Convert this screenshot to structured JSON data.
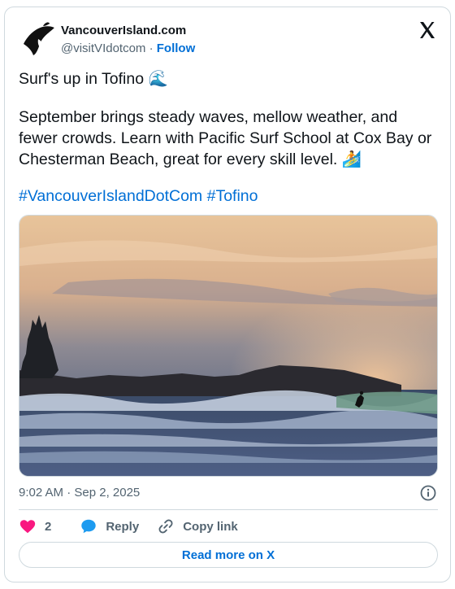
{
  "author": {
    "name": "VancouverIsland.com",
    "handle": "@visitVIdotcom",
    "separator": " · ",
    "follow_label": "Follow"
  },
  "tweet": {
    "line1": "Surf's up in Tofino",
    "line1_emoji": "🌊",
    "paragraph": "September brings steady waves, mellow weather, and fewer crowds. Learn with Pacific Surf School at Cox Bay or Chesterman Beach, great for every skill level.",
    "paragraph_emoji": "🏄",
    "hashtags": [
      "#VancouverIslandDotCom",
      "#Tofino"
    ]
  },
  "timestamp": "9:02 AM · Sep 2, 2025",
  "actions": {
    "like_count": "2",
    "reply_label": "Reply",
    "copy_label": "Copy link"
  },
  "read_more_label": "Read more on X",
  "colors": {
    "link": "#006fd6",
    "heart": "#f91880",
    "reply_icon": "#1d9bf0",
    "border": "#cfd9de",
    "secondary_text": "#536471"
  },
  "icons": {
    "platform": "x-logo-icon",
    "info": "info-icon",
    "like": "heart-icon",
    "reply": "reply-bubble-icon",
    "copy": "link-icon"
  }
}
